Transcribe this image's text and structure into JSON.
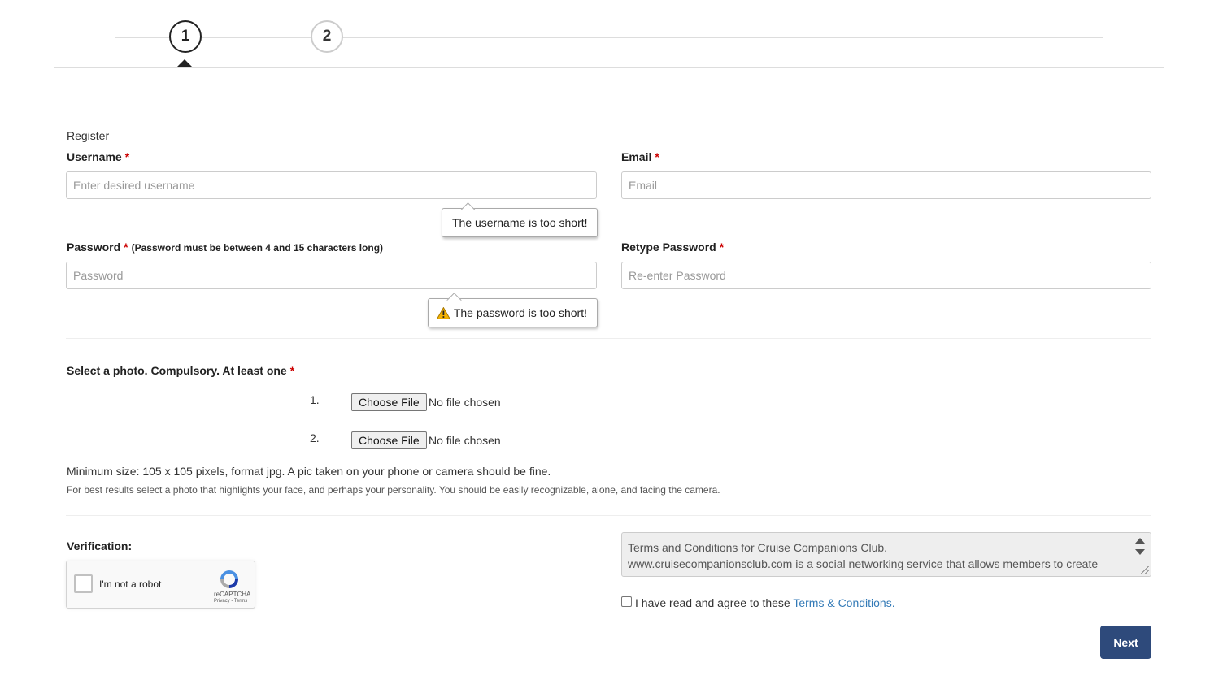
{
  "stepper": {
    "steps": [
      "1",
      "2"
    ],
    "active_step": 1
  },
  "register": {
    "title": "Register",
    "username": {
      "label": "Username",
      "required_mark": "*",
      "placeholder": "Enter desired username",
      "value": "",
      "error": "The username is too short!"
    },
    "email": {
      "label": "Email",
      "required_mark": "*",
      "placeholder": "Email",
      "value": ""
    },
    "password": {
      "label": "Password",
      "required_mark": "*",
      "hint": "(Password must be between 4 and 15 characters long)",
      "placeholder": "Password",
      "value": "",
      "error": "The password is too short!",
      "error_icon": "warning-icon"
    },
    "retype_password": {
      "label": "Retype Password",
      "required_mark": "*",
      "placeholder": "Re-enter Password",
      "value": ""
    }
  },
  "photos": {
    "label": "Select a photo. Compulsory. At least one",
    "required_mark": "*",
    "files": [
      {
        "number": "1.",
        "button": "Choose File",
        "status": "No file chosen"
      },
      {
        "number": "2.",
        "button": "Choose File",
        "status": "No file chosen"
      }
    ],
    "info_main": "Minimum size: 105 x 105 pixels, format jpg. A pic taken on your phone or camera should be fine.",
    "info_sub": "For best results select a photo that highlights your face, and perhaps your personality. You should be easily recognizable, alone, and facing the camera."
  },
  "verification": {
    "label": "Verification:",
    "captcha_text": "I'm not a robot",
    "captcha_brand": "reCAPTCHA",
    "captcha_links": "Privacy - Terms"
  },
  "terms": {
    "text": "Terms and Conditions for Cruise Companions Club.\nwww.cruisecompanionsclub.com is a social networking service that allows members to create unique personal profiles online in order to find and communicate with old and new friends. The",
    "agree_text": "I have read and agree to these",
    "agree_link": "Terms & Conditions."
  },
  "actions": {
    "next_label": "Next"
  },
  "colors": {
    "primary_button": "#2e4a7b",
    "required": "#cc0000",
    "link": "#337ab7"
  }
}
